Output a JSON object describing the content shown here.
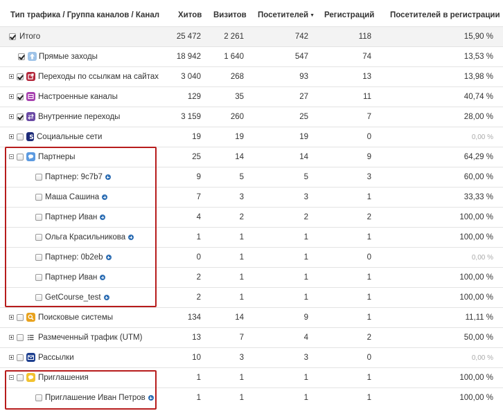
{
  "header": {
    "col_channel": "Тип трафика / Группа каналов / Канал",
    "col_hits": "Хитов",
    "col_visits": "Визитов",
    "col_visitors": "Посетителей",
    "col_registrations": "Регистраций",
    "col_visitors_reg": "Посетителей в регистрации"
  },
  "rows": [
    {
      "name": "Итого",
      "hits": "25 472",
      "visits": "2 261",
      "visitors": "742",
      "regs": "118",
      "pct": "15,90 %"
    },
    {
      "name": "Прямые заходы",
      "hits": "18 942",
      "visits": "1 640",
      "visitors": "547",
      "regs": "74",
      "pct": "13,53 %"
    },
    {
      "name": "Переходы по ссылкам на сайтах",
      "hits": "3 040",
      "visits": "268",
      "visitors": "93",
      "regs": "13",
      "pct": "13,98 %"
    },
    {
      "name": "Настроенные каналы",
      "hits": "129",
      "visits": "35",
      "visitors": "27",
      "regs": "11",
      "pct": "40,74 %"
    },
    {
      "name": "Внутренние переходы",
      "hits": "3 159",
      "visits": "260",
      "visitors": "25",
      "regs": "7",
      "pct": "28,00 %"
    },
    {
      "name": "Социальные сети",
      "hits": "19",
      "visits": "19",
      "visitors": "19",
      "regs": "0",
      "pct": "0,00 %"
    },
    {
      "name": "Партнеры",
      "hits": "25",
      "visits": "14",
      "visitors": "14",
      "regs": "9",
      "pct": "64,29 %"
    },
    {
      "name": "Партнер: 9c7b7",
      "hits": "9",
      "visits": "5",
      "visitors": "5",
      "regs": "3",
      "pct": "60,00 %"
    },
    {
      "name": "Маша Сашина",
      "hits": "7",
      "visits": "3",
      "visitors": "3",
      "regs": "1",
      "pct": "33,33 %"
    },
    {
      "name": "Партнер Иван",
      "hits": "4",
      "visits": "2",
      "visitors": "2",
      "regs": "2",
      "pct": "100,00 %"
    },
    {
      "name": "Ольга Красильникова",
      "hits": "1",
      "visits": "1",
      "visitors": "1",
      "regs": "1",
      "pct": "100,00 %"
    },
    {
      "name": "Партнер: 0b2eb",
      "hits": "0",
      "visits": "1",
      "visitors": "1",
      "regs": "0",
      "pct": "0,00 %"
    },
    {
      "name": "Партнер Иван",
      "hits": "2",
      "visits": "1",
      "visitors": "1",
      "regs": "1",
      "pct": "100,00 %"
    },
    {
      "name": "GetCourse_test",
      "hits": "2",
      "visits": "1",
      "visitors": "1",
      "regs": "1",
      "pct": "100,00 %"
    },
    {
      "name": "Поисковые системы",
      "hits": "134",
      "visits": "14",
      "visitors": "9",
      "regs": "1",
      "pct": "11,11 %"
    },
    {
      "name": "Размеченный трафик (UTM)",
      "hits": "13",
      "visits": "7",
      "visitors": "4",
      "regs": "2",
      "pct": "50,00 %"
    },
    {
      "name": "Рассылки",
      "hits": "10",
      "visits": "3",
      "visitors": "3",
      "regs": "0",
      "pct": "0,00 %"
    },
    {
      "name": "Приглашения",
      "hits": "1",
      "visits": "1",
      "visitors": "1",
      "regs": "1",
      "pct": "100,00 %"
    },
    {
      "name": "Приглашение Иван Петров",
      "hits": "1",
      "visits": "1",
      "visitors": "1",
      "regs": "1",
      "pct": "100,00 %"
    }
  ],
  "colors": {
    "direct_icon": "#9ec3e8",
    "links_icon": "#b3263a",
    "custom_icon": "#a63fae",
    "internal_icon": "#6b4aa5",
    "social_icon": "#1d2b78",
    "partners_icon": "#5c9ae0",
    "search_icon": "#e8a21d",
    "mail_icon": "#1d3f8f",
    "invite_icon": "#f2c230",
    "highlight": "#b71c1c",
    "link_plus": "#2f6fb4"
  }
}
